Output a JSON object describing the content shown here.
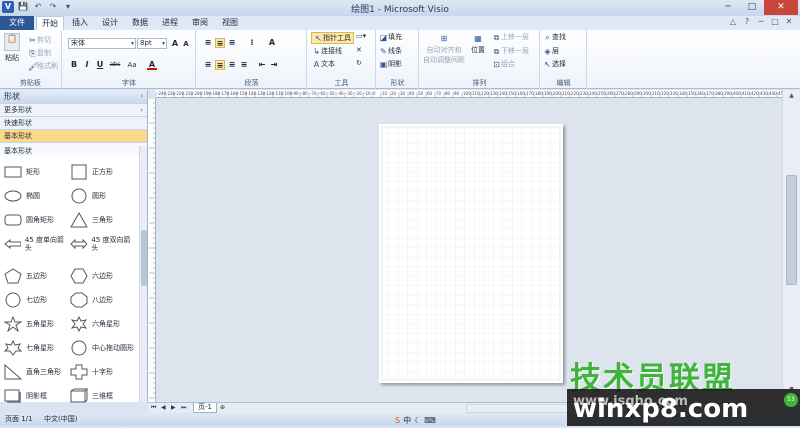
{
  "window": {
    "title": "绘图1 - Microsoft Visio",
    "qat": [
      "V",
      "💾",
      "↶",
      "↷",
      "▾"
    ],
    "controls": [
      "─",
      "□",
      "✕"
    ]
  },
  "tabs": {
    "file": "文件",
    "items": [
      "开始",
      "插入",
      "设计",
      "数据",
      "进程",
      "审阅",
      "视图"
    ],
    "active": "开始",
    "right_icons": [
      "△",
      "?",
      "─",
      "□",
      "✕"
    ]
  },
  "ribbon": {
    "clipboard": {
      "label": "剪贴板",
      "paste": "粘贴",
      "cut": "剪切",
      "copy": "复制",
      "format_painter": "格式刷"
    },
    "font": {
      "label": "字体",
      "font_name": "宋体",
      "font_size": "8pt",
      "grow": "A",
      "shrink": "A",
      "bold": "B",
      "italic": "I",
      "underline": "U",
      "strike": "abc",
      "case": "Aa",
      "color": "A"
    },
    "paragraph": {
      "label": "段落"
    },
    "tools": {
      "label": "工具",
      "pointer": "指针工具",
      "connector": "连接线",
      "text": "文本"
    },
    "shape": {
      "label": "形状",
      "fill": "填充",
      "line": "线条",
      "shadow": "阴影"
    },
    "arrange": {
      "label": "排列",
      "auto_align": "自动对齐和",
      "auto_space": "自动调整间距",
      "position": "位置",
      "bring_forward": "上移一层",
      "send_backward": "下移一层",
      "group": "组合"
    },
    "editing": {
      "label": "编辑",
      "find": "查找",
      "layers": "层",
      "select": "选择"
    }
  },
  "shapes_panel": {
    "header": "形状",
    "more_shapes": "更多形状",
    "quick_shapes": "快速形状",
    "basic_shapes_row": "基本形状",
    "stencil_title": "基本形状",
    "items": [
      {
        "label": "矩形",
        "icon": "rectangle"
      },
      {
        "label": "正方形",
        "icon": "square"
      },
      {
        "label": "椭圆",
        "icon": "ellipse"
      },
      {
        "label": "圆形",
        "icon": "circle"
      },
      {
        "label": "圆角矩形",
        "icon": "rounded-rectangle"
      },
      {
        "label": "三角形",
        "icon": "triangle"
      },
      {
        "label": "45 度单向箭头",
        "icon": "single-arrow"
      },
      {
        "label": "45 度双向箭头",
        "icon": "double-arrow"
      },
      {
        "label": "五边形",
        "icon": "pentagon"
      },
      {
        "label": "六边形",
        "icon": "hexagon"
      },
      {
        "label": "七边形",
        "icon": "heptagon"
      },
      {
        "label": "八边形",
        "icon": "octagon"
      },
      {
        "label": "五角星形",
        "icon": "star5"
      },
      {
        "label": "六角星形",
        "icon": "star6"
      },
      {
        "label": "七角星形",
        "icon": "star7"
      },
      {
        "label": "中心拖动圆形",
        "icon": "center-circle"
      },
      {
        "label": "直角三角形",
        "icon": "right-triangle"
      },
      {
        "label": "十字形",
        "icon": "cross"
      },
      {
        "label": "阴影框",
        "icon": "shadow-box"
      },
      {
        "label": "三维框",
        "icon": "3d-box"
      }
    ]
  },
  "ruler_labels": [
    "-240",
    "-230",
    "-220",
    "-210",
    "-200",
    "-190",
    "-180",
    "-170",
    "-160",
    "-150",
    "-140",
    "-130",
    "-120",
    "-110",
    "-100",
    "-90",
    "-80",
    "-70",
    "-60",
    "-50",
    "-40",
    "-30",
    "-20",
    "-10",
    "0",
    "10",
    "20",
    "30",
    "40",
    "50",
    "60",
    "70",
    "80",
    "90",
    "100",
    "110",
    "120",
    "130",
    "140",
    "150",
    "160",
    "170",
    "180",
    "190",
    "200",
    "210",
    "220",
    "230",
    "240",
    "250",
    "260",
    "270",
    "280",
    "290",
    "300",
    "310",
    "320",
    "330",
    "340",
    "350",
    "360",
    "370",
    "380",
    "390",
    "400",
    "410",
    "420",
    "430",
    "440",
    "450"
  ],
  "page_tabs": {
    "current": "页-1"
  },
  "status": {
    "page": "页面 1/1",
    "language": "中文(中国)"
  },
  "watermark": {
    "brand": "技术员联盟",
    "url": "www.jsgho.com",
    "site": "winxp8.com",
    "badge": "53"
  }
}
